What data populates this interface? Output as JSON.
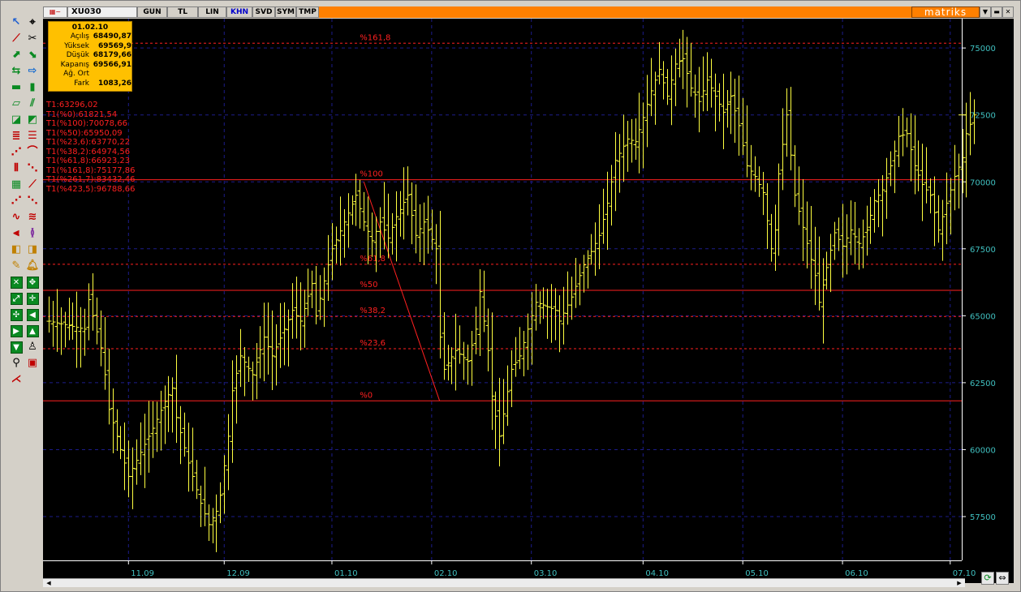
{
  "window": {
    "symbol": "XU030",
    "tabs": [
      {
        "label": "GUN",
        "active": false
      },
      {
        "label": "TL",
        "active": false
      },
      {
        "label": "LIN",
        "active": false
      },
      {
        "label": "KHN",
        "active": true
      },
      {
        "label": "SVD",
        "active": false
      },
      {
        "label": "SYM",
        "active": false
      },
      {
        "label": "TMP",
        "active": false
      }
    ],
    "brand": "matriks",
    "accent": "#ff8000"
  },
  "infobox": {
    "date": "01.02.10",
    "rows": [
      {
        "k": "Açılış",
        "v": "68490,87"
      },
      {
        "k": "Yüksek",
        "v": "69569,9"
      },
      {
        "k": "Düşük",
        "v": "68179,66"
      },
      {
        "k": "Kapanış",
        "v": "69566,91"
      },
      {
        "k": "Ağ. Ort",
        "v": ""
      },
      {
        "k": "Fark",
        "v": "1083,26"
      }
    ]
  },
  "fib_legend": [
    "T1:63296,02",
    "T1(%0):61821,54",
    "T1(%100):70078,66",
    "T1(%50):65950,09",
    "T1(%23,6):63770,22",
    "T1(%38,2):64974,56",
    "T1(%61,8):66923,23",
    "T1(%161,8):75177,86",
    "T1(%261,7):83432,46",
    "T1(%423,5):96788,66"
  ],
  "chart_data": {
    "type": "bar",
    "subtype": "ohlc-bars",
    "background": "#000000",
    "bar_color": "#ffff40",
    "fib_color": "#ff2020",
    "axis_label_color": "#40c0c0",
    "ylim": [
      56000,
      77000
    ],
    "yticks": [
      57500,
      60000,
      62500,
      65000,
      67500,
      70000,
      72500,
      75000
    ],
    "ytick_labels": [
      "57500",
      "60000",
      "62500",
      "65000",
      "67500",
      "70000",
      "72500",
      "75000"
    ],
    "xtick_labels": [
      "11.09",
      "12.09",
      "01.10",
      "02.10",
      "03.10",
      "04.10",
      "05.10",
      "06.10",
      "07.10"
    ],
    "xtick_bar_index": [
      20,
      44,
      71,
      96,
      121,
      149,
      174,
      199,
      226
    ],
    "fib_levels": [
      {
        "label": "%161,8",
        "value": 75177.86,
        "dashed": true
      },
      {
        "label": "%100",
        "value": 70078.66,
        "dashed": false
      },
      {
        "label": "%61,8",
        "value": 66923.23,
        "dashed": true
      },
      {
        "label": "%50",
        "value": 65950.09,
        "dashed": false
      },
      {
        "label": "%38,2",
        "value": 64974.56,
        "dashed": true
      },
      {
        "label": "%23,6",
        "value": 63770.22,
        "dashed": true
      },
      {
        "label": "%0",
        "value": 61821.54,
        "dashed": false
      }
    ],
    "trendline": {
      "from_bar": 79,
      "from_value": 70000,
      "to_bar": 98,
      "to_value": 61821.54
    },
    "segments": [
      [
        0,
        64800
      ],
      [
        9,
        64500
      ],
      [
        10,
        65600
      ],
      [
        13,
        63800
      ],
      [
        14,
        62800
      ],
      [
        15,
        61500
      ],
      [
        20,
        59000
      ],
      [
        26,
        60800
      ],
      [
        29,
        61800
      ],
      [
        31,
        62300
      ],
      [
        32,
        61200
      ],
      [
        35,
        59500
      ],
      [
        38,
        58000
      ],
      [
        40,
        57200
      ],
      [
        42,
        57700
      ],
      [
        43,
        58300
      ],
      [
        45,
        60500
      ],
      [
        46,
        62200
      ],
      [
        48,
        63500
      ],
      [
        51,
        62800
      ],
      [
        54,
        64200
      ],
      [
        56,
        63500
      ],
      [
        59,
        64500
      ],
      [
        61,
        65200
      ],
      [
        63,
        64800
      ],
      [
        66,
        66200
      ],
      [
        67,
        65000
      ],
      [
        69,
        66300
      ],
      [
        71,
        67500
      ],
      [
        74,
        68500
      ],
      [
        77,
        69500
      ],
      [
        79,
        68500
      ],
      [
        81,
        67800
      ],
      [
        83,
        68500
      ],
      [
        85,
        67900
      ],
      [
        87,
        68700
      ],
      [
        90,
        69500
      ],
      [
        92,
        68000
      ],
      [
        94,
        68500
      ],
      [
        95,
        68200
      ],
      [
        97,
        67500
      ],
      [
        98,
        64200
      ],
      [
        99,
        63000
      ],
      [
        102,
        63700
      ],
      [
        105,
        63300
      ],
      [
        107,
        64500
      ],
      [
        108,
        65900
      ],
      [
        110,
        63700
      ],
      [
        111,
        62000
      ],
      [
        113,
        60500
      ],
      [
        116,
        63000
      ],
      [
        118,
        63500
      ],
      [
        120,
        64500
      ],
      [
        122,
        65500
      ],
      [
        124,
        65400
      ],
      [
        127,
        65200
      ],
      [
        128,
        64800
      ],
      [
        131,
        65700
      ],
      [
        134,
        66900
      ],
      [
        136,
        67400
      ],
      [
        138,
        68000
      ],
      [
        140,
        69200
      ],
      [
        142,
        70800
      ],
      [
        145,
        71600
      ],
      [
        147,
        71500
      ],
      [
        149,
        72400
      ],
      [
        151,
        73400
      ],
      [
        153,
        74200
      ],
      [
        155,
        73200
      ],
      [
        157,
        74400
      ],
      [
        159,
        74600
      ],
      [
        161,
        73500
      ],
      [
        163,
        73000
      ],
      [
        165,
        73800
      ],
      [
        167,
        73200
      ],
      [
        169,
        72600
      ],
      [
        171,
        73200
      ],
      [
        173,
        72100
      ],
      [
        175,
        70600
      ],
      [
        177,
        70200
      ],
      [
        179,
        69600
      ],
      [
        181,
        67500
      ],
      [
        182,
        68200
      ],
      [
        183,
        70300
      ],
      [
        185,
        72500
      ],
      [
        187,
        69500
      ],
      [
        189,
        68300
      ],
      [
        190,
        67700
      ],
      [
        192,
        66500
      ],
      [
        193,
        65500
      ],
      [
        195,
        66800
      ],
      [
        197,
        68100
      ],
      [
        199,
        67600
      ],
      [
        201,
        68200
      ],
      [
        203,
        67700
      ],
      [
        205,
        68200
      ],
      [
        207,
        69300
      ],
      [
        209,
        69700
      ],
      [
        211,
        70600
      ],
      [
        213,
        71700
      ],
      [
        215,
        71800
      ],
      [
        217,
        70600
      ],
      [
        219,
        69900
      ],
      [
        221,
        69500
      ],
      [
        223,
        68200
      ],
      [
        225,
        69200
      ],
      [
        227,
        70200
      ],
      [
        229,
        70900
      ],
      [
        230,
        71800
      ],
      [
        232,
        72500
      ]
    ]
  }
}
